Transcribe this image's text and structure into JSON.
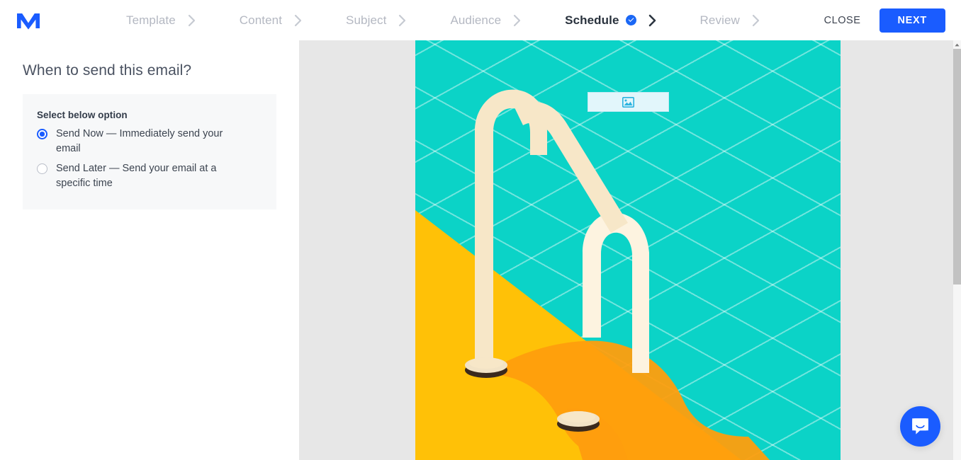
{
  "header": {
    "logo_name": "moosend-logo",
    "steps": [
      {
        "label": "Template",
        "state": "done"
      },
      {
        "label": "Content",
        "state": "done"
      },
      {
        "label": "Subject",
        "state": "done"
      },
      {
        "label": "Audience",
        "state": "done"
      },
      {
        "label": "Schedule",
        "state": "active",
        "badge_icon": "check-circle-icon"
      },
      {
        "label": "Review",
        "state": "upcoming"
      }
    ],
    "close_label": "CLOSE",
    "next_label": "NEXT"
  },
  "left_panel": {
    "title": "When to send this email?",
    "card": {
      "label": "Select below option",
      "options": [
        {
          "label": "Send Now — Immediately send your email",
          "selected": true
        },
        {
          "label": "Send Later — Send your email at a specific time",
          "selected": false
        }
      ]
    }
  },
  "preview": {
    "image_placeholder_icon": "image-placeholder-icon",
    "illustration": "swimming-pool-ladder-illustration"
  },
  "scrollbar": {
    "up_arrow_icon": "scroll-up-arrow-icon"
  },
  "chat": {
    "launcher_icon": "chat-bubble-smile-icon"
  },
  "colors": {
    "accent_blue": "#1a5cff",
    "badge_blue": "#1a67f5",
    "step_inactive": "#b4b8c2",
    "step_active": "#29323d",
    "card_bg": "#f7f8f9",
    "preview_bg": "#e7e7e7",
    "pool_water": "#0bd3c7",
    "pool_deck": "#ffc107",
    "pool_shadow": "#ff9e0d",
    "ladder_rail": "#f7e7c8",
    "ladder_rail_light": "#fdf3e0",
    "ladder_base": "#3b2a1d",
    "placeholder_bg": "#e2f6fb"
  }
}
